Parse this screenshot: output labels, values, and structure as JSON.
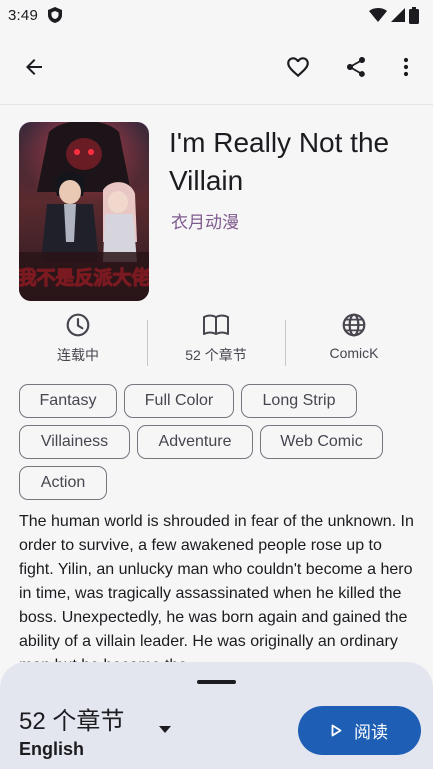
{
  "status_bar": {
    "time": "3:49",
    "icons": [
      "shield-icon",
      "wifi-icon",
      "signal-icon",
      "battery-icon"
    ]
  },
  "top_bar": {
    "icons": [
      "back-arrow-icon",
      "heart-outline-icon",
      "share-icon",
      "more-vert-icon"
    ]
  },
  "manga": {
    "title": "I'm Really Not the Villain",
    "author": "衣月动漫",
    "cover_art_text": "我不是反派大佬"
  },
  "stats": [
    {
      "icon": "clock-icon",
      "label": "连载中"
    },
    {
      "icon": "book-icon",
      "label": "52 个章节"
    },
    {
      "icon": "globe-icon",
      "label": "ComicK"
    }
  ],
  "genres": [
    "Fantasy",
    "Full Color",
    "Long Strip",
    "Villainess",
    "Adventure",
    "Web Comic",
    "Action"
  ],
  "description": "The human world is shrouded in fear of the unknown. In order to survive, a few awakened people rose up to fight. Yilin, an unlucky man who couldn't become a hero in time, was tragically assassinated when he killed the boss. Unexpectedly, he was born again and gained the ability of a villain leader. He was originally an ordinary man but he became the",
  "bottom_sheet": {
    "chapter_count": "52 个章节",
    "language": "English",
    "read_label": "阅读"
  },
  "colors": {
    "accent": "#1e5fb5",
    "author": "#7e5a8e",
    "sheet_bg": "#e3e6ef",
    "page_bg": "#f6f6f7"
  }
}
